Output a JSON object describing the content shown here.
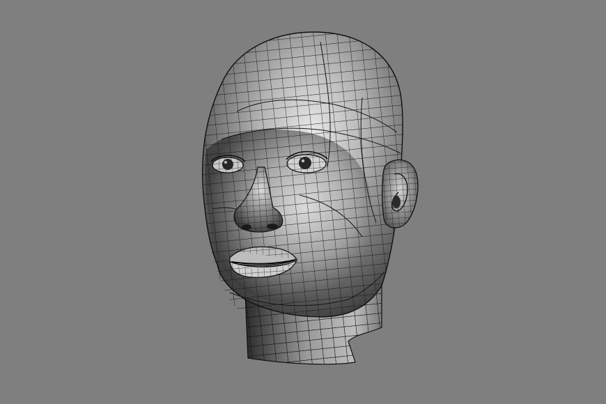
{
  "viewport": {
    "background_color": "#7f7f7f",
    "render_mode": "wireframe-on-shaded",
    "wire_color": "#141414"
  },
  "model": {
    "subject": "human-head",
    "shading": "grey-smooth",
    "highlight_color": "#e6e6e6",
    "shadow_color": "#1e1e1e",
    "parts": [
      "cranium",
      "face",
      "left-eye",
      "right-eye",
      "nose",
      "lips",
      "ear",
      "neck"
    ]
  }
}
